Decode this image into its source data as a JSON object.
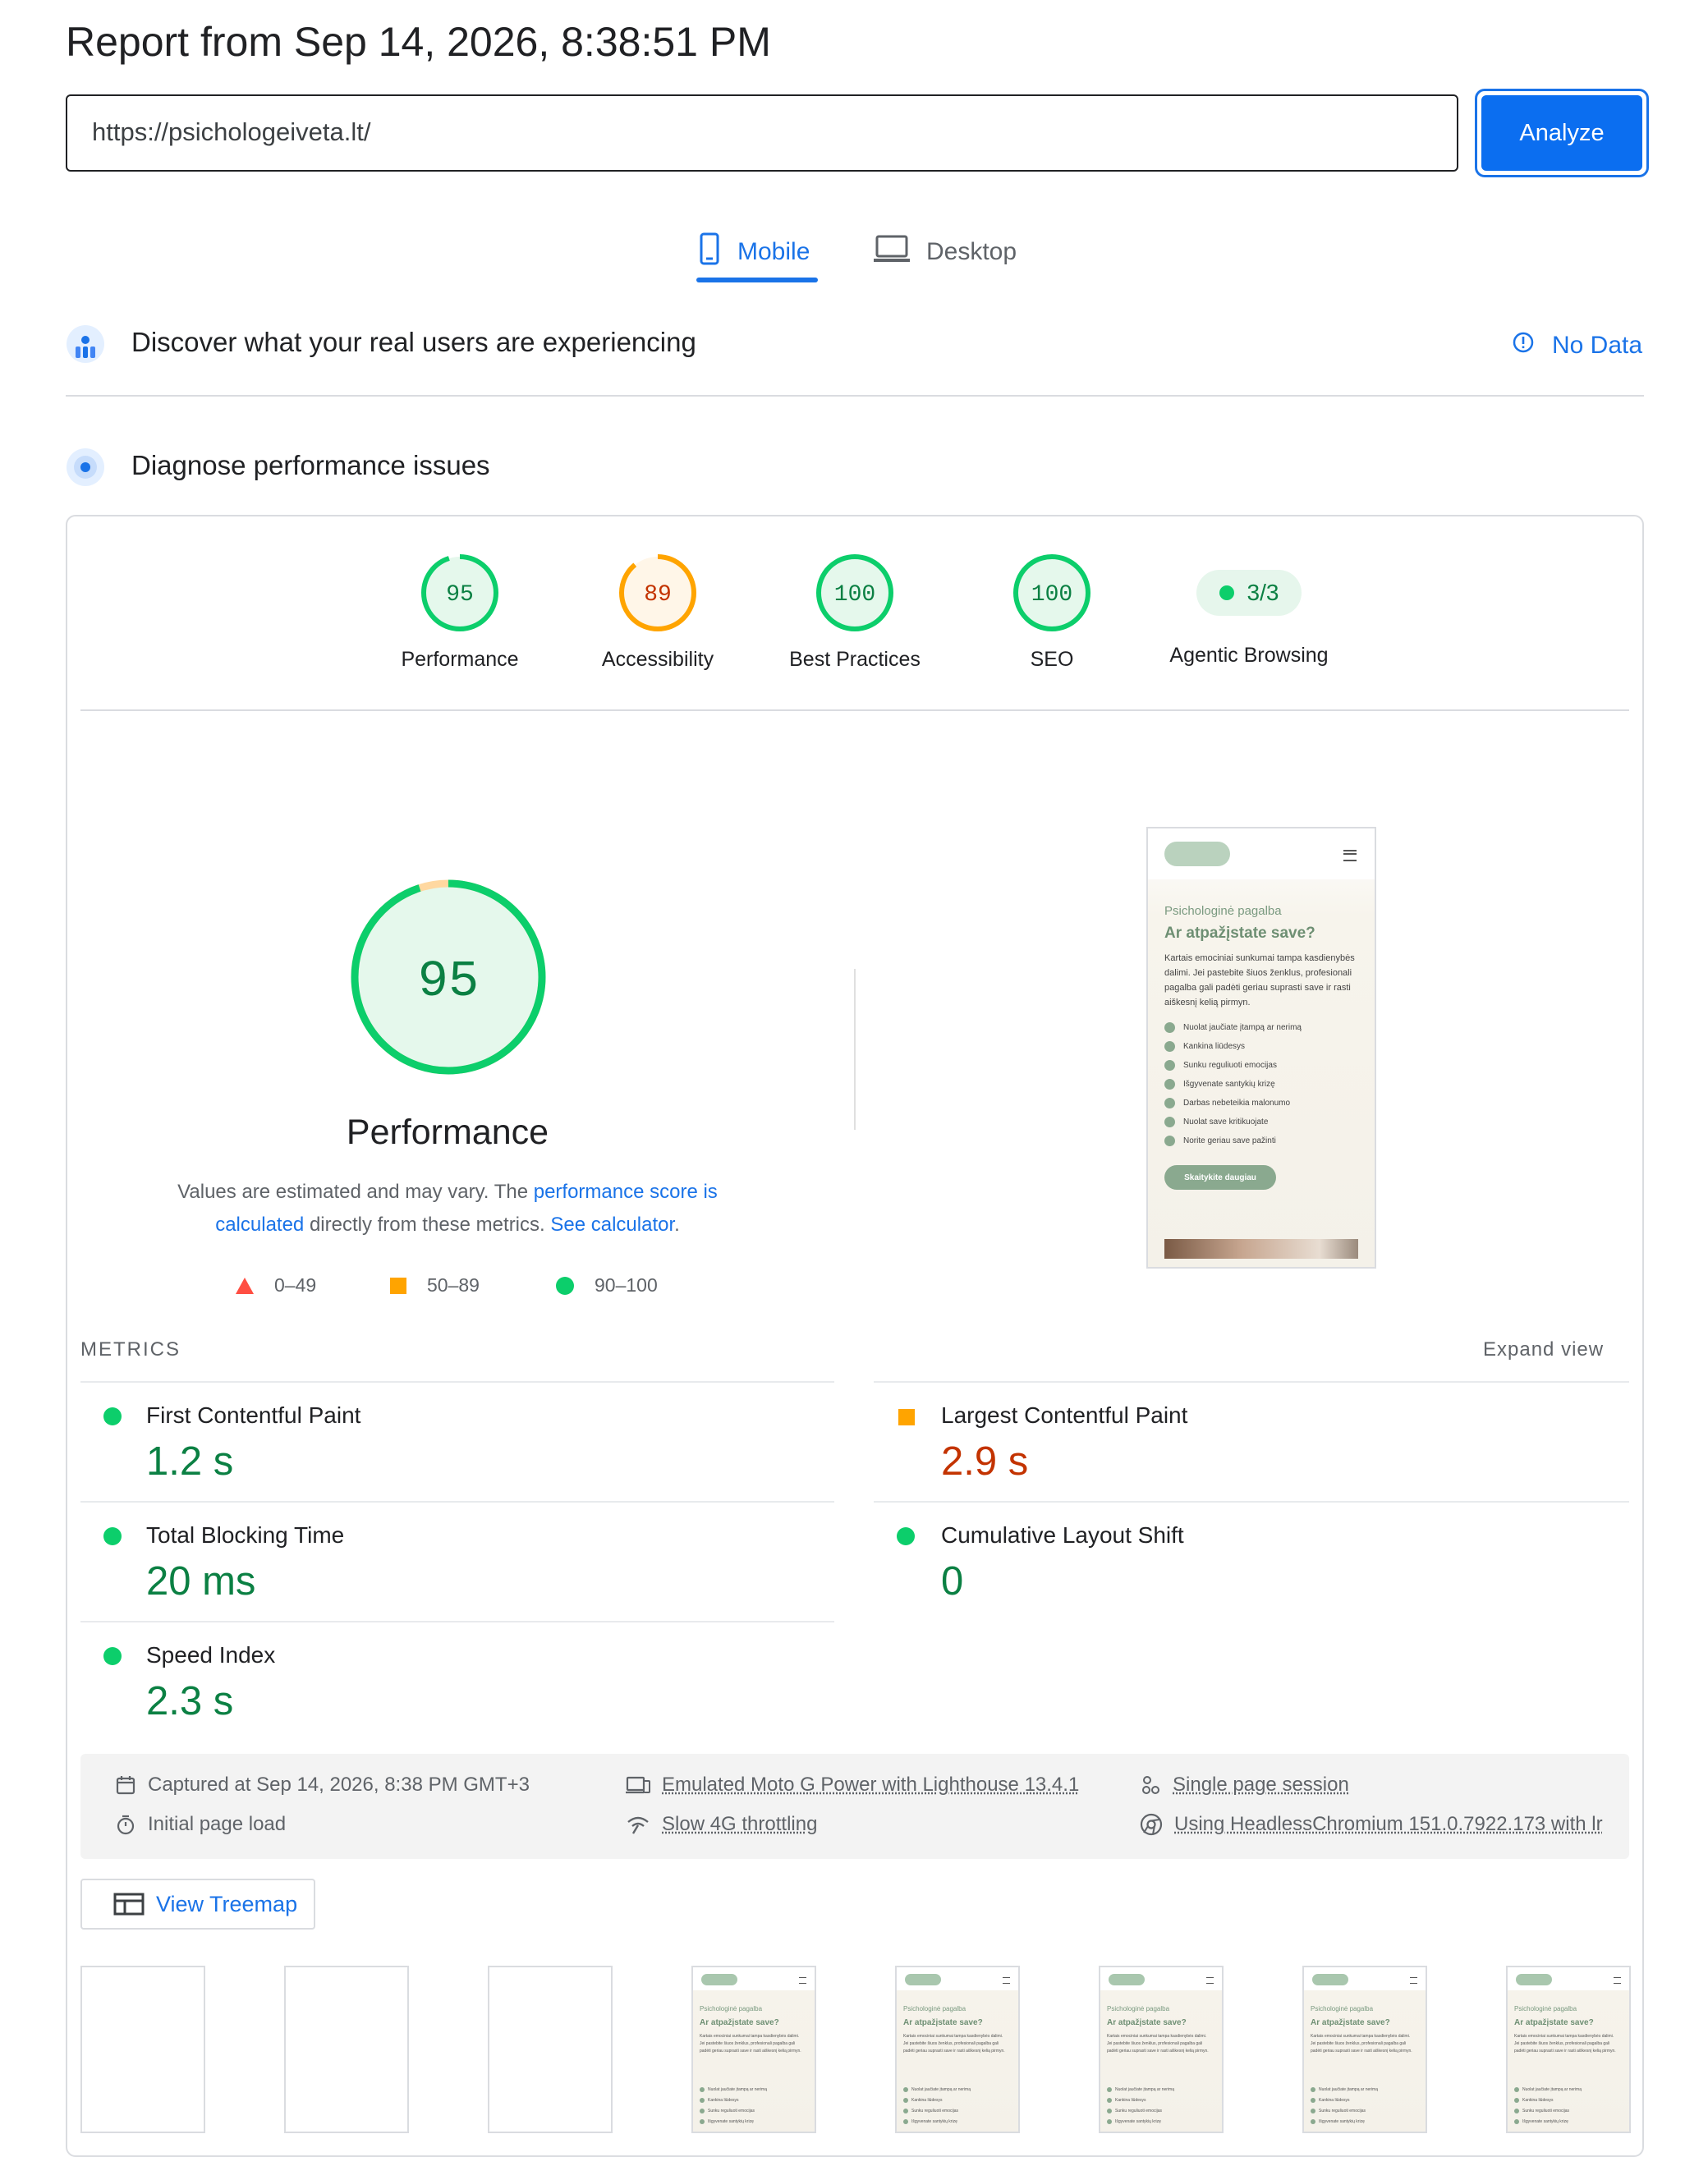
{
  "title": "Report from Sep 14, 2026, 8:38:51 PM",
  "url_input": {
    "value": "https://psichologeiveta.lt/"
  },
  "analyze_label": "Analyze",
  "tabs": [
    {
      "label": "Mobile",
      "active": true
    },
    {
      "label": "Desktop",
      "active": false
    }
  ],
  "crux": {
    "title": "Discover what your real users are experiencing",
    "status": "No Data"
  },
  "diagnose": {
    "title": "Diagnose performance issues"
  },
  "scores": [
    {
      "value": "95",
      "label": "Performance",
      "fraction": 0.95,
      "color": "#0cce6b"
    },
    {
      "value": "89",
      "label": "Accessibility",
      "fraction": 0.89,
      "color": "#ffa400"
    },
    {
      "value": "100",
      "label": "Best Practices",
      "fraction": 1.0,
      "color": "#0cce6b"
    },
    {
      "value": "100",
      "label": "SEO",
      "fraction": 1.0,
      "color": "#0cce6b"
    }
  ],
  "agentic": {
    "value": "3/3",
    "label": "Agentic Browsing"
  },
  "performance_big": {
    "value": "95",
    "label": "Performance",
    "fraction": 0.95
  },
  "note": {
    "part1": "Values are estimated and may vary. The ",
    "link1": "performance score is calculated",
    "part2": " directly from these metrics. ",
    "link2": "See calculator",
    "part3": "."
  },
  "legend": [
    "0–49",
    "50–89",
    "90–100"
  ],
  "screenshot": {
    "eyebrow": "Psichologinė pagalba",
    "heading": "Ar atpažįstate save?",
    "body": "Kartais emociniai sunkumai tampa kasdienybės dalimi. Jei pastebite šiuos ženklus, profesionali pagalba gali padėti geriau suprasti save ir rasti aiškesnį kelią pirmyn.",
    "items": [
      "Nuolat jaučiate įtampą ar nerimą",
      "Kankina liūdesys",
      "Sunku reguliuoti emocijas",
      "Išgyvenate santykių krizę",
      "Darbas nebeteikia malonumo",
      "Nuolat save kritikuojate",
      "Norite geriau save pažinti"
    ],
    "button": "Skaitykite daugiau"
  },
  "metrics_header": "METRICS",
  "expand_view": "Expand view",
  "metrics": [
    {
      "name": "First Contentful Paint",
      "value": "1.2 s",
      "status": "good"
    },
    {
      "name": "Largest Contentful Paint",
      "value": "2.9 s",
      "status": "average"
    },
    {
      "name": "Total Blocking Time",
      "value": "20 ms",
      "status": "good"
    },
    {
      "name": "Cumulative Layout Shift",
      "value": "0",
      "status": "good"
    },
    {
      "name": "Speed Index",
      "value": "2.3 s",
      "status": "good"
    }
  ],
  "info": {
    "captured": "Captured at Sep 14, 2026, 8:38 PM GMT+3",
    "initial": "Initial page load",
    "device": "Emulated Moto G Power with Lighthouse 13.4.1",
    "throttle": "Slow 4G throttling",
    "session": "Single page session",
    "browser": "Using HeadlessChromium 151.0.7922.173 with lr"
  },
  "treemap_label": "View Treemap",
  "colors": {
    "accent": "#1a73e8",
    "pass": "#0cce6b",
    "average": "#ffa400",
    "fail": "#ff4e42"
  }
}
